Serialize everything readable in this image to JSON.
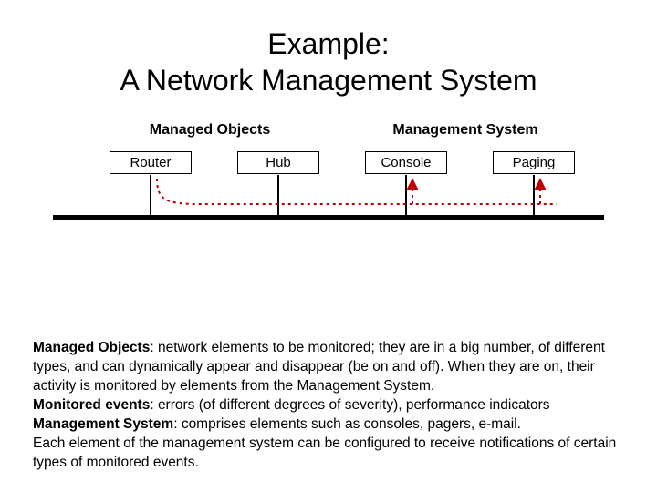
{
  "title_line1": "Example:",
  "title_line2": "A Network Management System",
  "groups": {
    "managed_objects": "Managed Objects",
    "management_system": "Management System"
  },
  "nodes": {
    "router": "Router",
    "hub": "Hub",
    "console": "Console",
    "paging": "Paging"
  },
  "desc": {
    "mo_label": "Managed Objects",
    "mo_text": ":  network elements to be monitored; they are in a big number, of different types, and can dynamically appear and disappear (be on and off). When they are on, their activity is  monitored by  elements from the Management System.",
    "me_label": "Monitored events",
    "me_text": ": errors (of different degrees of severity),  performance indicators",
    "ms_label": "Management System",
    "ms_text": ": comprises elements such as  consoles, pagers, e-mail.",
    "tail": "Each element of the management system can be configured  to receive notifications of certain types of monitored events."
  },
  "colors": {
    "dotted_red": "#c00000"
  }
}
